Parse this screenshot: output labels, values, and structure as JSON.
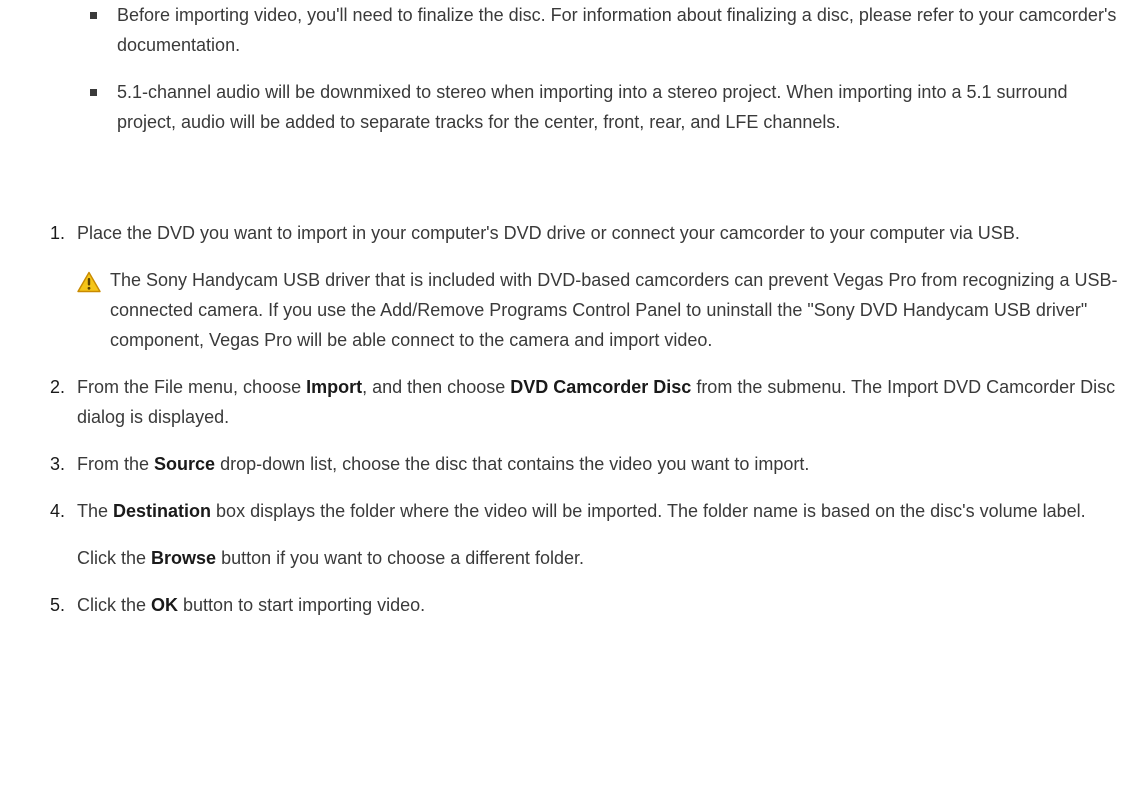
{
  "bullets": [
    "Before importing video, you'll need to finalize the disc. For information about finalizing a disc, please refer to your camcorder's documentation.",
    "5.1-channel audio will be downmixed to stereo when importing into a stereo project. When importing into a 5.1 surround project, audio will be added to separate tracks for the center, front, rear, and LFE channels."
  ],
  "steps": [
    {
      "num": "1.",
      "text": "Place the DVD you want to import in your computer's DVD drive or connect your camcorder to your computer via USB.",
      "note": "The Sony Handycam USB driver that is included with DVD-based camcorders can prevent Vegas Pro from recognizing a USB-connected camera. If you use the Add/Remove Programs Control Panel to uninstall the \"Sony DVD Handycam USB driver\" component, Vegas Pro will be able connect to the camera and import video.",
      "note_icon": "warning-icon"
    },
    {
      "num": "2.",
      "t1": "From the File menu, choose ",
      "b1": "Import",
      "t2": ", and then choose ",
      "b2": "DVD Camcorder Disc",
      "t3": " from the submenu. The Import DVD Camcorder Disc dialog is displayed."
    },
    {
      "num": "3.",
      "t1": "From the ",
      "b1": "Source",
      "t2": " drop-down list, choose the disc that contains the video you want to import."
    },
    {
      "num": "4.",
      "t1": "The ",
      "b1": "Destination",
      "t2": " box displays the folder where the video will be imported. The folder name is based on the disc's volume label.",
      "f1": "Click the ",
      "fb": "Browse",
      "f2": " button if you want to choose a different folder."
    },
    {
      "num": "5.",
      "t1": "Click the ",
      "b1": "OK",
      "t2": " button to start importing video."
    }
  ],
  "colors": {
    "text": "#3a3a3a",
    "warning_fill": "#f5c518",
    "warning_border": "#c98a00"
  }
}
